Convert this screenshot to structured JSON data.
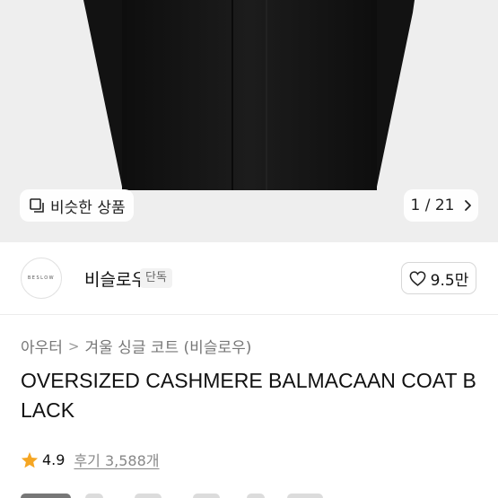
{
  "hero": {
    "similar_label": "비슷한 상품",
    "counter_current": "1",
    "counter_sep": "/",
    "counter_total": "21"
  },
  "brand": {
    "logo_text": "BESLOW",
    "name": "비슬로우",
    "badge": "단독",
    "like_count": "9.5만"
  },
  "breadcrumb": {
    "items": [
      "아우터",
      "겨울 싱글 코트 (비슬로우)"
    ],
    "separator": ">"
  },
  "product": {
    "title": "OVERSIZED CASHMERE BALMACAAN COAT BLACK"
  },
  "rating": {
    "score": "4.9",
    "reviews_label": "후기 3,588개"
  },
  "colors": {
    "star": "#f5a623",
    "hero_bg": "#eeeeee",
    "coat": "#161616"
  },
  "icons": [
    "similar-products-icon",
    "chevron-right-icon",
    "heart-icon",
    "star-icon"
  ]
}
